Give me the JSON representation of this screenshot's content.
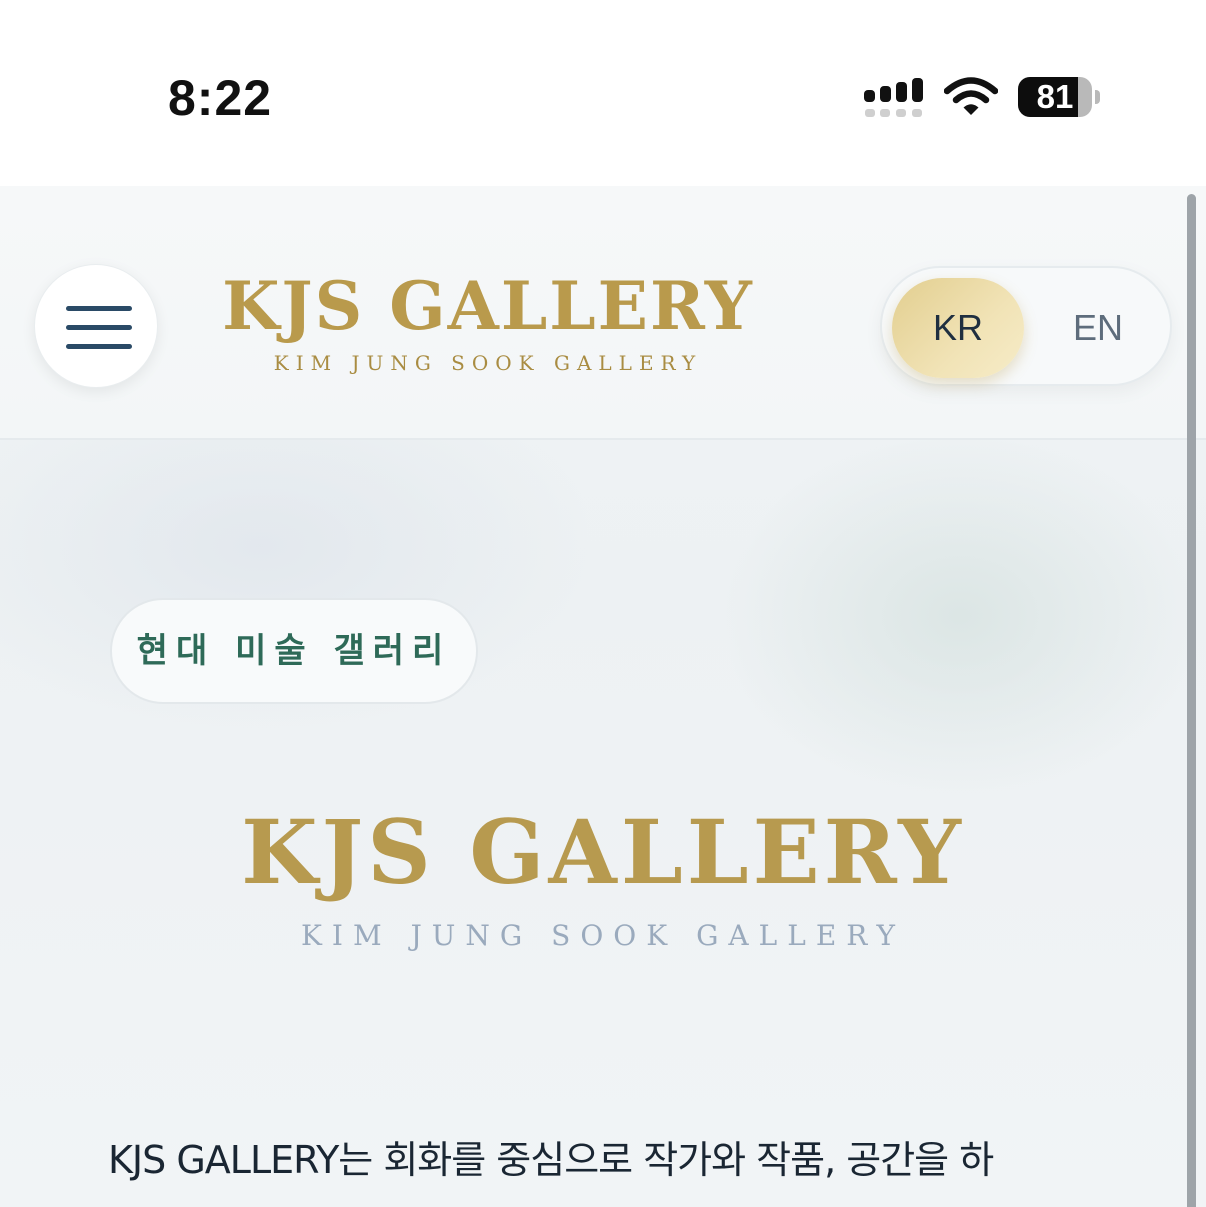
{
  "status_bar": {
    "time": "8:22",
    "battery_percent": "81",
    "battery_level": 0.81,
    "icons": [
      "signal-icon",
      "wifi-icon",
      "battery-icon"
    ]
  },
  "header": {
    "menu_icon": "hamburger-menu-icon",
    "logo_title": "KJS GALLERY",
    "logo_subtitle": "KIM JUNG SOOK GALLERY",
    "language": {
      "options": [
        "KR",
        "EN"
      ],
      "selected": "KR"
    }
  },
  "main": {
    "badge": "현대 미술 갤러리",
    "hero_title": "KJS GALLERY",
    "hero_subtitle": "KIM JUNG SOOK GALLERY",
    "intro_text": "KJS GALLERY는 회화를 중심으로 작가와 작품, 공간을 하"
  },
  "colors": {
    "gold": "#b99a4c",
    "navy": "#2a4a66",
    "green": "#2e6a58",
    "slate": "#9aaabd"
  }
}
